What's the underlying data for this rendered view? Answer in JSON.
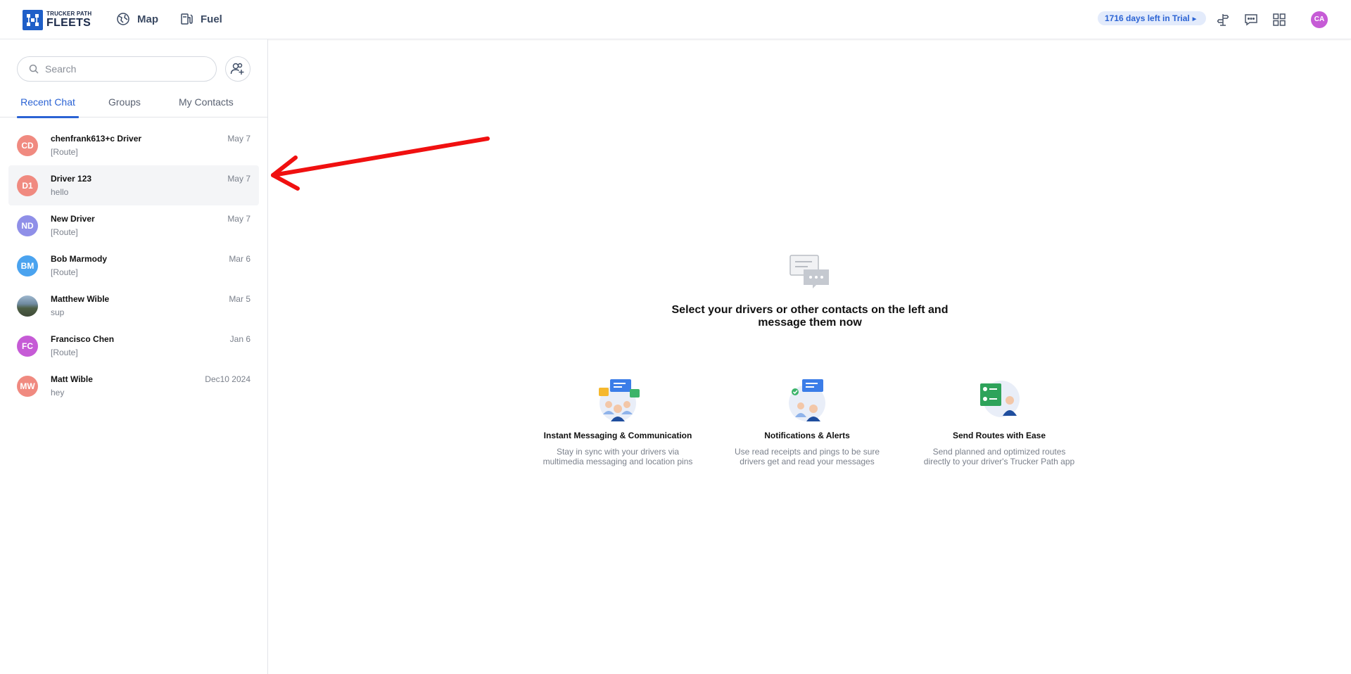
{
  "header": {
    "logo_top": "TRUCKER PATH",
    "logo_bottom": "FLEETS",
    "nav": {
      "map": "Map",
      "fuel": "Fuel"
    },
    "trial": "1716 days left in Trial",
    "avatar_initials": "CA",
    "icons": [
      "signpost-icon",
      "chat-icon",
      "apps-grid-icon"
    ]
  },
  "sidebar": {
    "search_placeholder": "Search",
    "tabs": [
      "Recent Chat",
      "Groups",
      "My Contacts"
    ],
    "active_tab": "Recent Chat",
    "chats": [
      {
        "initials": "CD",
        "name": "chenfrank613+c Driver",
        "preview": "[Route]",
        "date": "May 7",
        "color": "#f08a80"
      },
      {
        "initials": "D1",
        "name": "Driver 123",
        "preview": "hello",
        "date": "May 7",
        "color": "#f08a80"
      },
      {
        "initials": "ND",
        "name": "New Driver",
        "preview": "[Route]",
        "date": "May 7",
        "color": "#8f8fe8"
      },
      {
        "initials": "BM",
        "name": "Bob Marmody",
        "preview": "[Route]",
        "date": "Mar 6",
        "color": "#4aa3ef"
      },
      {
        "initials": "",
        "name": "Matthew Wible",
        "preview": "sup",
        "date": "Mar 5",
        "color": "#6f8aa0"
      },
      {
        "initials": "FC",
        "name": "Francisco Chen",
        "preview": "[Route]",
        "date": "Jan 6",
        "color": "#c65bd6"
      },
      {
        "initials": "MW",
        "name": "Matt Wible",
        "preview": "hey",
        "date": "Dec10 2024",
        "color": "#f08a80"
      }
    ]
  },
  "main": {
    "empty_title": "Select your drivers or other contacts on the left and message them now",
    "features": [
      {
        "title": "Instant Messaging & Communication",
        "desc": "Stay in sync with your drivers via multimedia messaging and location pins"
      },
      {
        "title": "Notifications & Alerts",
        "desc": "Use read receipts and pings to be sure drivers get and read your messages"
      },
      {
        "title": "Send Routes with Ease",
        "desc": "Send planned and optimized routes directly to your driver's Trucker Path app"
      }
    ]
  },
  "colors": {
    "accent": "#2b63d4",
    "annotation_arrow": "#f01010"
  }
}
